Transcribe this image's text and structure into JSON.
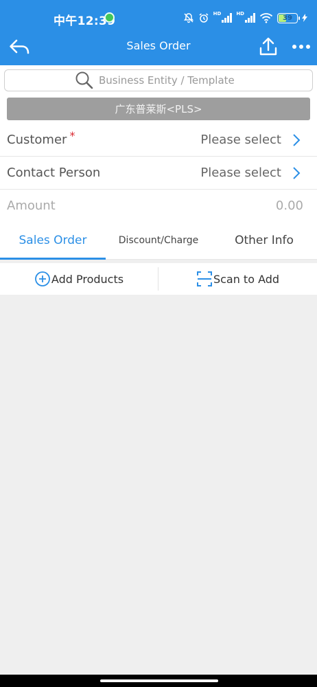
{
  "status_bar": {
    "time": "中午12:39",
    "battery": "39"
  },
  "header": {
    "title": "Sales Order"
  },
  "search": {
    "placeholder": "Business Entity / Template"
  },
  "entity": {
    "name": "广东普莱斯<PLS>"
  },
  "fields": {
    "customer": {
      "label": "Customer",
      "required_mark": "*",
      "value": "Please select"
    },
    "contact": {
      "label": "Contact Person",
      "value": "Please select"
    },
    "amount": {
      "label": "Amount",
      "value": "0.00"
    }
  },
  "tabs": [
    {
      "label": "Sales Order",
      "active": true
    },
    {
      "label": "Discount/Charge",
      "active": false
    },
    {
      "label": "Other Info",
      "active": false
    }
  ],
  "actions": {
    "add_products": "Add Products",
    "scan_to_add": "Scan to Add"
  },
  "colors": {
    "primary": "#2b8fe6",
    "required": "#d9282f",
    "entity_bar": "#9e9e9e"
  }
}
